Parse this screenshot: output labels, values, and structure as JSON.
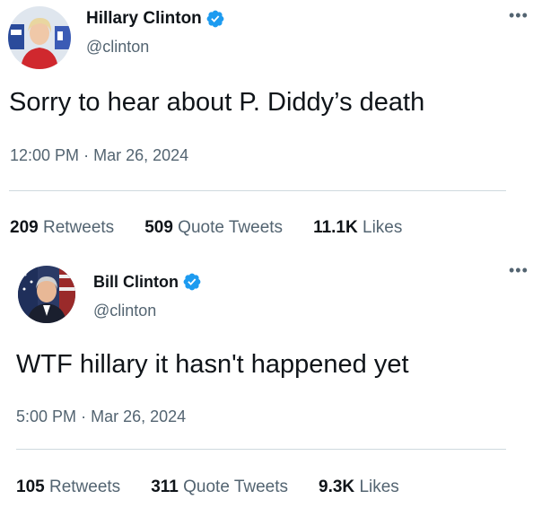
{
  "tweets": [
    {
      "author": {
        "name": "Hillary Clinton",
        "handle": "@clinton",
        "verified": true
      },
      "text": "Sorry to hear about P. Diddy’s death",
      "time": "12:00 PM",
      "date": "Mar 26, 2024",
      "stats": {
        "retweets": {
          "count": "209",
          "label": "Retweets"
        },
        "quotes": {
          "count": "509",
          "label": "Quote Tweets"
        },
        "likes": {
          "count": "11.1K",
          "label": "Likes"
        }
      }
    },
    {
      "author": {
        "name": "Bill Clinton",
        "handle": "@clinton",
        "verified": true
      },
      "text": "WTF hillary it hasn't happened yet",
      "time": "5:00 PM",
      "date": "Mar 26, 2024",
      "stats": {
        "retweets": {
          "count": "105",
          "label": "Retweets"
        },
        "quotes": {
          "count": "311",
          "label": "Quote Tweets"
        },
        "likes": {
          "count": "9.3K",
          "label": "Likes"
        }
      }
    }
  ],
  "icons": {
    "verified": "verified-badge-icon",
    "more": "more-options-icon"
  },
  "colors": {
    "verified": "#1d9bf0",
    "text": "#0f1419",
    "secondary": "#536471",
    "divider": "#cfd9de"
  },
  "ui": {
    "more": "•••",
    "separator": "·"
  }
}
